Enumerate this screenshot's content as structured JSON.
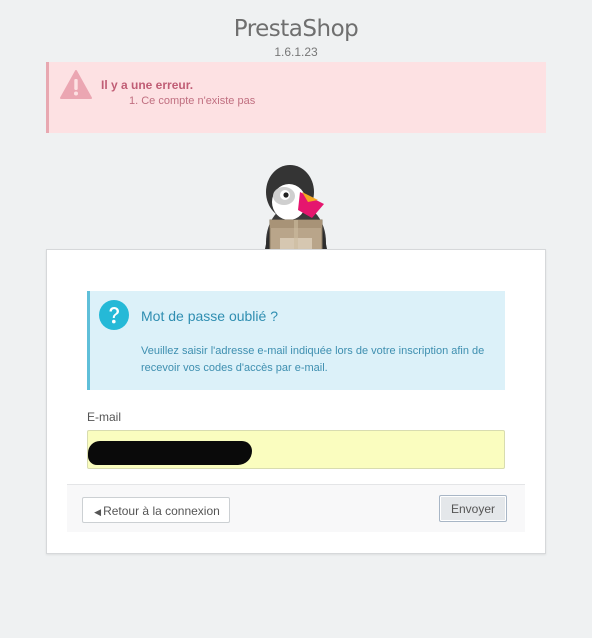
{
  "brand": {
    "name": "PrestaShop",
    "version": "1.6.1.23"
  },
  "error": {
    "title": "Il y a une erreur.",
    "items": [
      "1. Ce compte n'existe pas"
    ]
  },
  "form": {
    "heading": "Mot de passe oublié ?",
    "instructions": "Veuillez saisir l'adresse e-mail indiquée lors de votre inscription afin de recevoir vos codes d'accès par e-mail.",
    "email_label": "E-mail",
    "email_value": "",
    "back_label": "Retour à la connexion",
    "submit_label": "Envoyer"
  },
  "colors": {
    "error_bg": "#fde1e3",
    "error_text": "#c05d75",
    "info_bg": "#dcf1f9",
    "info_text": "#2f8eb1",
    "input_autofill_bg": "#fafdbf"
  },
  "icons": {
    "error": "warning-triangle-icon",
    "help": "question-circle-icon",
    "back": "caret-left-icon",
    "mascot": "puffin-mascot"
  }
}
